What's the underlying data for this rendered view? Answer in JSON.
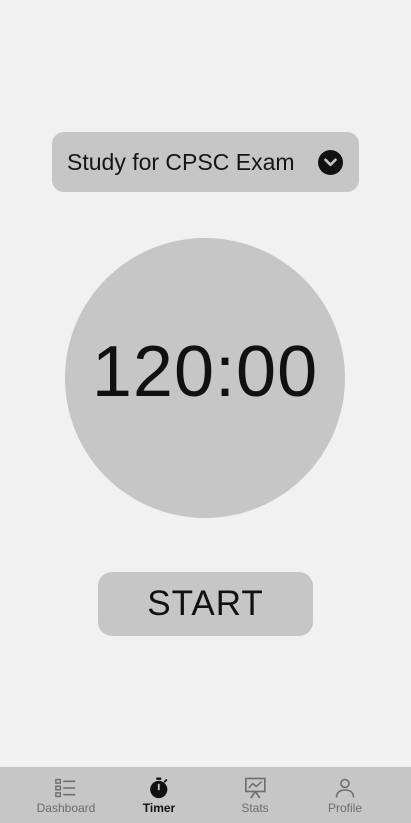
{
  "task_selector": {
    "label": "Study for CPSC Exam",
    "icon": "chevron-down-icon"
  },
  "timer": {
    "display": "120:00"
  },
  "start_button": {
    "label": "START"
  },
  "bottom_nav": {
    "active": "Timer",
    "items": [
      {
        "label": "Dashboard",
        "icon": "list-icon"
      },
      {
        "label": "Timer",
        "icon": "stopwatch-icon"
      },
      {
        "label": "Stats",
        "icon": "presentation-chart-icon"
      },
      {
        "label": "Profile",
        "icon": "person-icon"
      }
    ]
  },
  "colors": {
    "background": "#f1f1f1",
    "surface": "#c6c6c6",
    "text": "#111111",
    "nav_inactive": "#6d6d6d"
  }
}
